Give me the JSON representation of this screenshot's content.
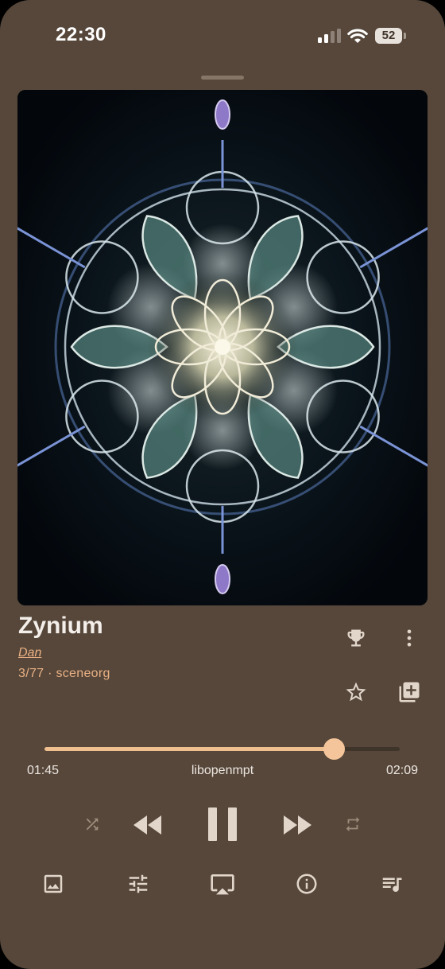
{
  "status_bar": {
    "time": "22:30",
    "battery_level": "52"
  },
  "track": {
    "title": "Zynium",
    "artist": "Dan",
    "meta": "3/77 · sceneorg"
  },
  "playback": {
    "elapsed": "01:45",
    "engine": "libopenmpt",
    "duration": "02:09",
    "progress_fraction": 0.814,
    "state": "playing"
  },
  "icons": {
    "top_actions": [
      "trophy-icon",
      "more-vert-icon",
      "star-outline-icon",
      "add-to-playlist-icon"
    ],
    "transport": [
      "shuffle-icon",
      "rewind-icon",
      "pause-icon",
      "fast-forward-icon",
      "repeat-icon"
    ],
    "bottom_bar": [
      "image-icon",
      "equalizer-icon",
      "airplay-icon",
      "info-icon",
      "queue-music-icon"
    ]
  },
  "colors": {
    "background": "#56473a",
    "accent": "#f0bf90",
    "icon": "#e2d6cb",
    "icon_dim": "#9c8c7c",
    "link": "#e9b084"
  }
}
